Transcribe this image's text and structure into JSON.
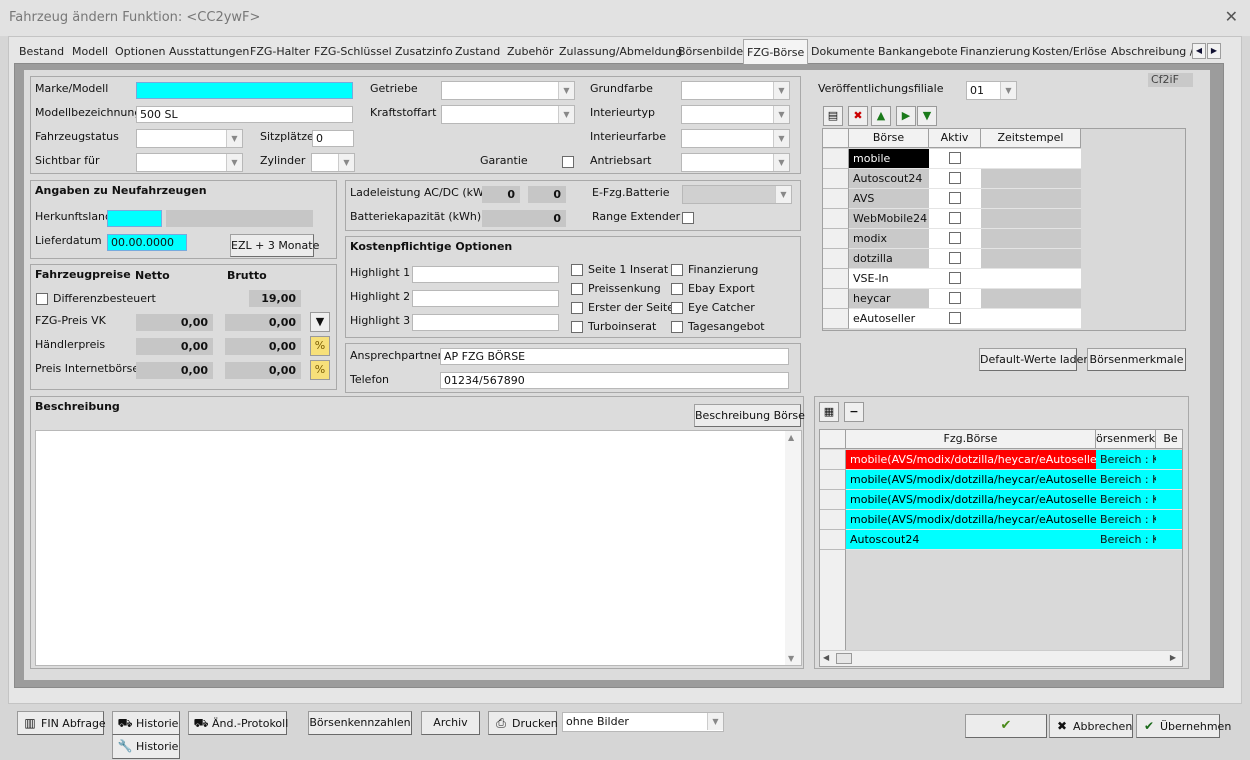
{
  "window": {
    "title": "Fahrzeug ändern   Funktion: <CC2ywF>"
  },
  "tabs": [
    "Bestand",
    "Modell",
    "Optionen",
    "Ausstattungen",
    "FZG-Halter",
    "FZG-Schlüssel",
    "Zusatzinfo",
    "Zustand",
    "Zubehör",
    "Zulassung/Abmeldung",
    "Börsenbilder",
    "FZG-Börse",
    "Dokumente",
    "Bankangebote",
    "Finanzierung",
    "Kosten/Erlöse",
    "Abschreibung / V"
  ],
  "active_tab": "FZG-Börse",
  "top": {
    "marke_label": "Marke/Modell",
    "modellbez_label": "Modellbezeichnung",
    "modellbez_value": "500 SL",
    "status_label": "Fahrzeugstatus",
    "sitzplaetze_label": "Sitzplätze",
    "sitzplaetze_value": "0",
    "sichtbar_label": "Sichtbar für",
    "zylinder_label": "Zylinder",
    "getriebe_label": "Getriebe",
    "kraftstoff_label": "Kraftstoffart",
    "garantie_label": "Garantie",
    "grundfarbe_label": "Grundfarbe",
    "interieurtyp_label": "Interieurtyp",
    "interieurfarbe_label": "Interieurfarbe",
    "antriebsart_label": "Antriebsart"
  },
  "neu": {
    "title": "Angaben zu Neufahrzeugen",
    "herkunft_label": "Herkunftsland",
    "lieferdatum_label": "Lieferdatum",
    "lieferdatum_value": "00.00.0000",
    "ezl_button": "EZL + 3 Monate"
  },
  "preise": {
    "title": "Fahrzeugpreise",
    "netto": "Netto",
    "brutto": "Brutto",
    "diff_label": "Differenzbesteuert",
    "mwst": "19,00",
    "vk_label": "FZG-Preis VK",
    "vk_netto": "0,00",
    "vk_brutto": "0,00",
    "haendler_label": "Händlerpreis",
    "haendler_netto": "0,00",
    "haendler_brutto": "0,00",
    "internet_label": "Preis Internetbörsen",
    "internet_netto": "0,00",
    "internet_brutto": "0,00"
  },
  "batterie": {
    "ladeleistung_label": "Ladeleistung AC/DC (kW)",
    "ac": "0",
    "dc": "0",
    "kapazitaet_label": "Batteriekapazität (kWh)",
    "kapazitaet": "0",
    "efzg_label": "E-Fzg.Batterie",
    "range_label": "Range Extender"
  },
  "kosten": {
    "title": "Kostenpflichtige Optionen",
    "highlight1": "Highlight 1",
    "highlight2": "Highlight 2",
    "highlight3": "Highlight 3",
    "opt": [
      "Seite 1 Inserat",
      "Preissenkung",
      "Erster der Seite",
      "Turboinserat",
      "Finanzierung",
      "Ebay Export",
      "Eye Catcher",
      "Tagesangebot"
    ]
  },
  "kontakt": {
    "ansprech_label": "Ansprechpartner",
    "ansprech_value": "AP FZG BÖRSE",
    "telefon_label": "Telefon",
    "telefon_value": "01234/567890"
  },
  "beschreibung": {
    "title": "Beschreibung",
    "button": "Beschreibung Börse"
  },
  "right": {
    "filiale_label": "Veröffentlichungsfiliale",
    "filiale_value": "01",
    "code": "Cf2iF",
    "grid_headers": [
      "Börse",
      "Aktiv",
      "Zeitstempel"
    ],
    "boersen": [
      "mobile",
      "Autoscout24",
      "AVS",
      "WebMobile24",
      "modix",
      "dotzilla",
      "VSE-In",
      "heycar",
      "eAutoseller"
    ],
    "default_button": "Default-Werte laden",
    "merkmale_button": "Börsenmerkmale",
    "grid2_headers": [
      "Fzg.Börse",
      "örsenmerkm",
      "Be"
    ],
    "grid2_rows": [
      {
        "boerse": "mobile(AVS/modix/dotzilla/heycar/eAutoseller)",
        "merkmal": "Bereich : K",
        "color": "#ff0000",
        "text": "#ffffff"
      },
      {
        "boerse": "mobile(AVS/modix/dotzilla/heycar/eAutoseller)",
        "merkmal": "Bereich : K",
        "color": "#00ffff",
        "text": "#000000"
      },
      {
        "boerse": "mobile(AVS/modix/dotzilla/heycar/eAutoseller)",
        "merkmal": "Bereich : K",
        "color": "#00ffff",
        "text": "#000000"
      },
      {
        "boerse": "mobile(AVS/modix/dotzilla/heycar/eAutoseller)",
        "merkmal": "Bereich : K",
        "color": "#00ffff",
        "text": "#000000"
      },
      {
        "boerse": "Autoscout24",
        "merkmal": "Bereich : K",
        "color": "#00ffff",
        "text": "#000000"
      }
    ]
  },
  "bottom": {
    "fin": "FIN Abfrage",
    "historie": "Historie",
    "aend": "Änd.-Protokoll",
    "kennzahlen": "Börsenkennzahlen",
    "archiv": "Archiv",
    "drucken": "Drucken",
    "druck_option": "ohne Bilder",
    "historie2": "Historie",
    "ok": "OK",
    "abbrechen": "Abbrechen",
    "uebernehmen": "Übernehmen"
  }
}
